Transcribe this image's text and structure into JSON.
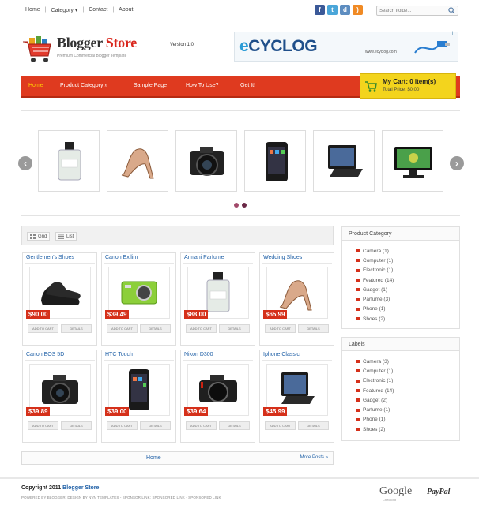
{
  "top_nav": [
    "Home",
    "Category",
    "Contact",
    "About"
  ],
  "top_nav_separator": "|",
  "search": {
    "placeholder": "Search Itoide..."
  },
  "social": [
    {
      "icon": "facebook-icon",
      "glyph": "f",
      "color": "#3b5998"
    },
    {
      "icon": "twitter-icon",
      "glyph": "t",
      "color": "#4aa6d9"
    },
    {
      "icon": "digg-icon",
      "glyph": "d",
      "color": "#5d8dc0"
    },
    {
      "icon": "rss-icon",
      "glyph": ")",
      "color": "#f08a24"
    }
  ],
  "brand": {
    "part1": "Blogger",
    "part2": "Store",
    "version": "Version 1.0",
    "tagline": "Premium Commercial Blogger Template"
  },
  "banner": {
    "brand_e": "e",
    "brand_rest": "CYCLOG",
    "url": "www.ecyclog.com",
    "ad_badge": "i"
  },
  "main_nav": [
    {
      "label": "Home",
      "active": true
    },
    {
      "label": "Product Category »",
      "active": false
    },
    {
      "label": "Sample Page",
      "active": false
    },
    {
      "label": "How To Use?",
      "active": false
    },
    {
      "label": "Get It!",
      "active": false
    }
  ],
  "cart": {
    "title": "My Cart: 0 item(s)",
    "subtitle": "Total Price: $0.00"
  },
  "slider": {
    "prev": "‹",
    "next": "›",
    "items": [
      "perfume",
      "heels",
      "dslr",
      "phone",
      "tablet",
      "monitor"
    ]
  },
  "view_toggle": {
    "grid": "Grid",
    "list": "List"
  },
  "products": [
    {
      "name": "Gentlemen's Shoes",
      "price": "$90.00",
      "image": "shoes"
    },
    {
      "name": "Canon Exilim",
      "price": "$39.49",
      "image": "compact"
    },
    {
      "name": "Armani Parfume",
      "price": "$88.00",
      "image": "perfume"
    },
    {
      "name": "Wedding Shoes",
      "price": "$65.99",
      "image": "heels"
    },
    {
      "name": "Canon EOS 5D",
      "price": "$39.89",
      "image": "dslr"
    },
    {
      "name": "HTC Touch",
      "price": "$39.00",
      "image": "phone"
    },
    {
      "name": "Nikon D300",
      "price": "$39.64",
      "image": "nikon"
    },
    {
      "name": "Iphone Classic",
      "price": "$45.99",
      "image": "tablet"
    }
  ],
  "product_buttons": {
    "add": "ADD TO CART",
    "details": "DETAILS"
  },
  "pager": {
    "home": "Home",
    "more": "More Posts »"
  },
  "sidebar": {
    "category_title": "Product Category",
    "categories": [
      "Camera (1)",
      "Computer (1)",
      "Electronic (1)",
      "Featured (14)",
      "Gadget (1)",
      "Parfume (3)",
      "Phone (1)",
      "Shoes (2)"
    ],
    "labels_title": "Labels",
    "labels": [
      "Camera (3)",
      "Computer (1)",
      "Electronic (1)",
      "Featured (14)",
      "Gadget (2)",
      "Parfume (1)",
      "Phone (1)",
      "Shoes (2)"
    ]
  },
  "footer": {
    "copyright_prefix": "Copyright 2011",
    "store": "Blogger Store",
    "credits": "POWERED BY BLOGGER. DESIGN BY NVN TEMPLATES - SPONSOR LINK: SPONSORED LINK - SPONSORED LINK",
    "google": "Google",
    "google_sub": "Checkout",
    "paypal": "PayPal"
  },
  "colors": {
    "nav_red": "#df3a1f",
    "nav_active": "#ffd400",
    "cart_yellow": "#f3d41d",
    "price_red": "#d5301a",
    "link_blue": "#1e5fa6",
    "brand_red": "#d9261c"
  }
}
